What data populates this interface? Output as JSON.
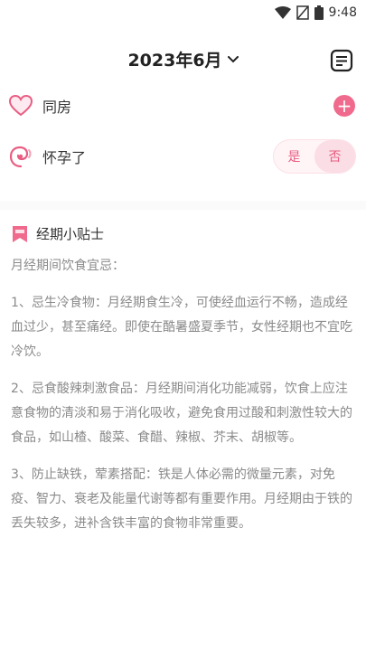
{
  "status_bar": {
    "time": "9:48",
    "icons": [
      "wifi-icon",
      "signal-off-icon",
      "battery-icon"
    ]
  },
  "header": {
    "month": "2023年6月",
    "icons": [
      "chevron-down-icon",
      "notes-icon"
    ]
  },
  "rows": {
    "intercourse": {
      "label": "同房",
      "icon": "heart-icon",
      "action_icon": "plus-icon"
    },
    "pregnant": {
      "label": "怀孕了",
      "icon": "embryo-icon",
      "toggle": {
        "yes": "是",
        "no": "否",
        "selected": "否"
      }
    }
  },
  "tips": {
    "title": "经期小贴士",
    "icon": "bookmark-icon",
    "paragraphs": [
      "月经期间饮食宜忌：",
      "1、忌生冷食物：月经期食生冷，可使经血运行不畅，造成经血过少，甚至痛经。即使在酷暑盛夏季节，女性经期也不宜吃冷饮。",
      "2、忌食酸辣刺激食品：月经期间消化功能减弱，饮食上应注意食物的清淡和易于消化吸收，避免食用过酸和刺激性较大的食品，如山楂、酸菜、食醋、辣椒、芥末、胡椒等。",
      "3、防止缺铁，荤素搭配：铁是人体必需的微量元素，对免疫、智力、衰老及能量代谢等都有重要作用。月经期由于铁的丢失较多，进补含铁丰富的食物非常重要。"
    ]
  },
  "colors": {
    "accent": "#f06a8d",
    "text": "#333333",
    "muted": "#8a8a8a"
  }
}
